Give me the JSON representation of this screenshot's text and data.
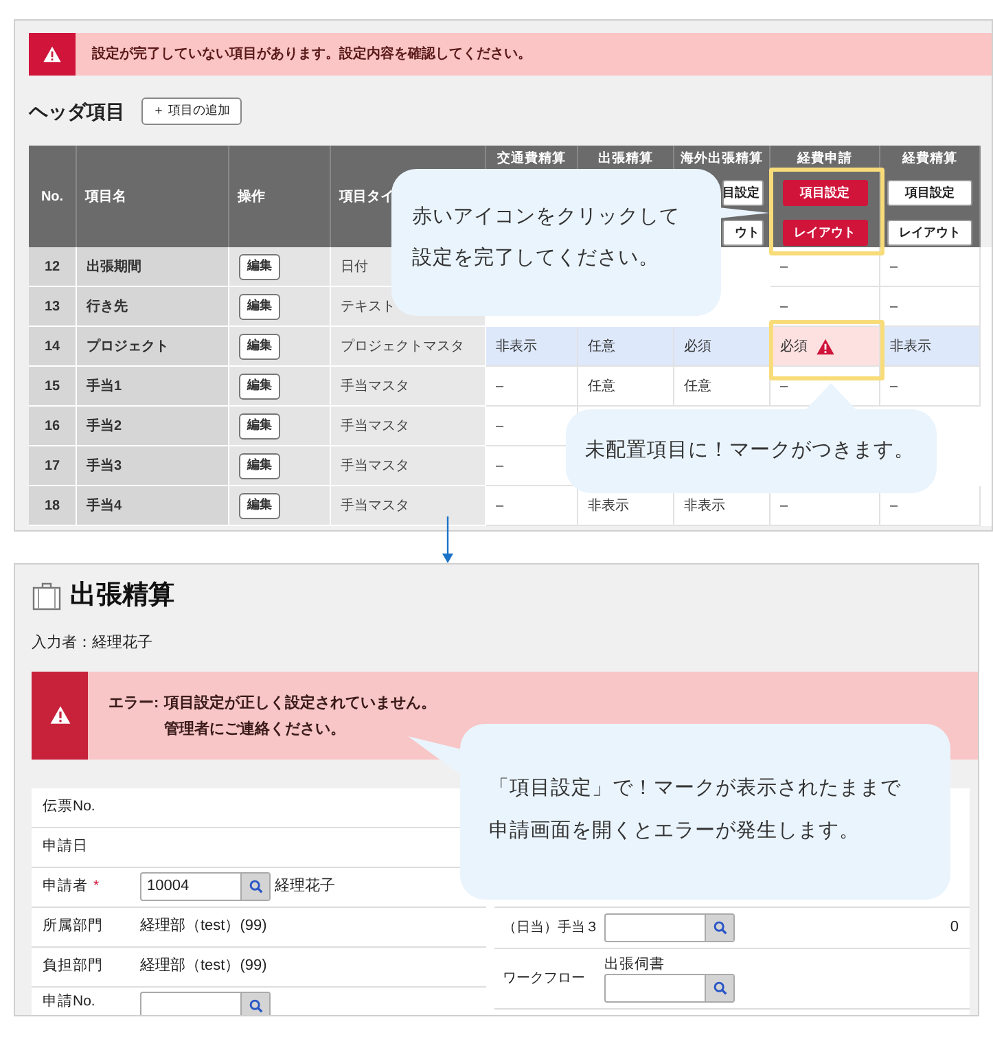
{
  "settings_panel": {
    "alert": {
      "message": "設定が完了していない項目があります。設定内容を確認してください。"
    },
    "section": {
      "title": "ヘッダ項目",
      "add_button": "＋ 項目の追加"
    },
    "table": {
      "columns": [
        "No.",
        "項目名",
        "操作",
        "項目タイ"
      ],
      "workflow_columns": [
        {
          "label": "交通費精算"
        },
        {
          "label": "出張精算"
        },
        {
          "label": "海外出張精算",
          "buttons": [
            {
              "label": "目設定",
              "alert": false
            },
            {
              "label": "ウト",
              "alert": false
            }
          ]
        },
        {
          "label": "経費申請",
          "buttons": [
            {
              "label": "項目設定",
              "alert": true
            },
            {
              "label": "レイアウト",
              "alert": true
            }
          ]
        },
        {
          "label": "経費精算",
          "buttons": [
            {
              "label": "項目設定",
              "alert": false
            },
            {
              "label": "レイアウト",
              "alert": false
            }
          ]
        }
      ],
      "rows": [
        {
          "no": "12",
          "name": "出張期間",
          "edit": "編集",
          "type": "日付",
          "selected": false,
          "cells": [
            null,
            null,
            null,
            {
              "text": "–",
              "flag": false
            },
            {
              "text": "–",
              "flag": false
            }
          ]
        },
        {
          "no": "13",
          "name": "行き先",
          "edit": "編集",
          "type": "テキスト",
          "selected": false,
          "cells": [
            null,
            null,
            null,
            {
              "text": "–",
              "flag": false
            },
            {
              "text": "–",
              "flag": false
            }
          ]
        },
        {
          "no": "14",
          "name": "プロジェクト",
          "edit": "編集",
          "type": "プロジェクトマスタ",
          "selected": true,
          "cells": [
            {
              "text": "非表示",
              "flag": false
            },
            {
              "text": "任意",
              "flag": false
            },
            {
              "text": "必須",
              "flag": false
            },
            {
              "text": "必須",
              "flag": true
            },
            {
              "text": "非表示",
              "flag": false
            }
          ]
        },
        {
          "no": "15",
          "name": "手当1",
          "edit": "編集",
          "type": "手当マスタ",
          "selected": false,
          "cells": [
            {
              "text": "–",
              "flag": false
            },
            {
              "text": "任意",
              "flag": false
            },
            {
              "text": "任意",
              "flag": false
            },
            {
              "text": "–",
              "flag": false
            },
            {
              "text": "–",
              "flag": false
            }
          ]
        },
        {
          "no": "16",
          "name": "手当2",
          "edit": "編集",
          "type": "手当マスタ",
          "selected": false,
          "cells": [
            {
              "text": "–",
              "flag": false
            },
            null,
            null,
            null,
            null
          ]
        },
        {
          "no": "17",
          "name": "手当3",
          "edit": "編集",
          "type": "手当マスタ",
          "selected": false,
          "cells": [
            {
              "text": "–",
              "flag": false
            },
            null,
            null,
            null,
            null
          ]
        },
        {
          "no": "18",
          "name": "手当4",
          "edit": "編集",
          "type": "手当マスタ",
          "selected": false,
          "cells": [
            {
              "text": "–",
              "flag": false
            },
            {
              "text": "非表示",
              "flag": false
            },
            {
              "text": "非表示",
              "flag": false
            },
            {
              "text": "–",
              "flag": false
            },
            {
              "text": "–",
              "flag": false
            }
          ]
        }
      ]
    }
  },
  "form_panel": {
    "title": "出張精算",
    "entered_by": "入力者：経理花子",
    "error": {
      "label": "エラー:",
      "lines": [
        "項目設定が正しく設定されていません。",
        "管理者にご連絡ください。"
      ]
    },
    "left_rows": [
      {
        "kind": "empty",
        "label": "伝票No."
      },
      {
        "kind": "empty",
        "label": "申請日"
      },
      {
        "kind": "lookup",
        "label": "申請者",
        "mark": "*",
        "value": "10004",
        "name": "経理花子"
      },
      {
        "kind": "text",
        "label": "所属部門",
        "value": "経理部（test）(99)"
      },
      {
        "kind": "text",
        "label": "負担部門",
        "value": "経理部（test）(99)"
      },
      {
        "kind": "lookup",
        "label": "申請No."
      }
    ],
    "right_rows": [
      {
        "kind": "lookup",
        "label": "（日当）手当３",
        "amount": "0"
      },
      {
        "kind": "lookup",
        "label": "ワークフロー",
        "caption": "出張伺書"
      }
    ]
  },
  "callouts": [
    {
      "lines": [
        "赤いアイコンをクリックして",
        "設定を完了してください。"
      ]
    },
    {
      "lines": [
        "未配置項目に！マークがつきます。"
      ]
    },
    {
      "lines": [
        "「項目設定」で！マークが表示されたままで",
        "申請画面を開くとエラーが発生します。"
      ]
    }
  ]
}
